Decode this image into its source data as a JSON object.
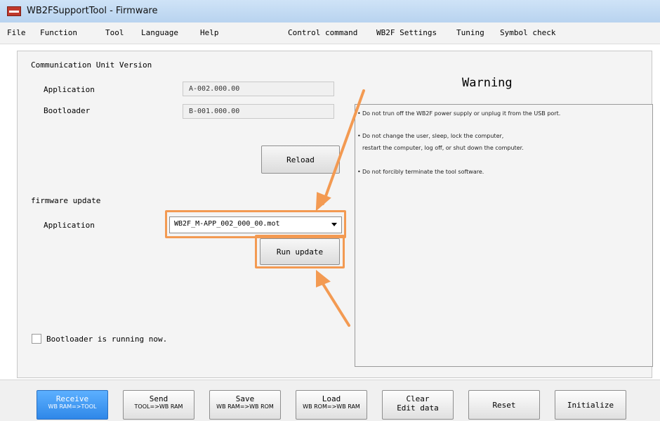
{
  "window": {
    "title": "WB2FSupportTool - Firmware"
  },
  "menu": {
    "left": [
      "File",
      "Function",
      "Tool",
      "Language",
      "Help"
    ],
    "right": [
      "Control command",
      "WB2F Settings",
      "Tuning",
      "Symbol check"
    ]
  },
  "comm": {
    "section_label": "Communication Unit Version",
    "app_label": "Application",
    "app_value": "A-002.000.00",
    "boot_label": "Bootloader",
    "boot_value": "B-001.000.00",
    "reload_label": "Reload"
  },
  "firmware": {
    "section_label": "firmware update",
    "app_label": "Application",
    "selected_file": "WB2F_M-APP_002_000_00.mot",
    "run_label": "Run update"
  },
  "bootloader_check": {
    "label": "Bootloader is running now.",
    "checked": false
  },
  "warning": {
    "title": "Warning",
    "lines": [
      "Do not trun off the WB2F power supply or unplug it from the USB port.",
      "Do not change the user, sleep, lock the computer,",
      "restart the computer, log off, or shut down the computer.",
      "Do not forcibly terminate the tool software."
    ]
  },
  "toolbar": {
    "buttons": [
      {
        "label": "Receive",
        "sub": "WB RAM=>TOOL",
        "active": true
      },
      {
        "label": "Send",
        "sub": "TOOL=>WB RAM"
      },
      {
        "label": "Save",
        "sub": "WB RAM=>WB ROM"
      },
      {
        "label": "Load",
        "sub": "WB ROM=>WB RAM"
      },
      {
        "label": "Clear",
        "sub": "Edit data"
      },
      {
        "label": "Reset"
      },
      {
        "label": "Initialize"
      }
    ]
  },
  "colors": {
    "accent_orange": "#f39a52",
    "active_blue": "#3a93f2"
  }
}
